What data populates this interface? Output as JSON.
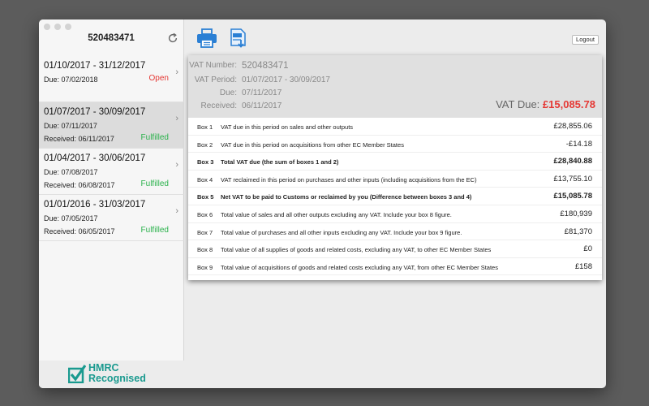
{
  "sidebar": {
    "title": "520483471",
    "periods": [
      {
        "range": "01/10/2017 - 31/12/2017",
        "line2": "Due: 07/02/2018",
        "line3": "",
        "status": "Open"
      },
      {
        "range": "01/07/2017 - 30/09/2017",
        "line2": "Due: 07/11/2017",
        "line3": "Received: 06/11/2017",
        "status": "Fulfilled"
      },
      {
        "range": "01/04/2017 - 30/06/2017",
        "line2": "Due: 07/08/2017",
        "line3": "Received: 06/08/2017",
        "status": "Fulfilled"
      },
      {
        "range": "01/01/2016 - 31/03/2017",
        "line2": "Due: 07/05/2017",
        "line3": "Received: 06/05/2017",
        "status": "Fulfilled"
      }
    ],
    "logo_text_1": "HMRC",
    "logo_text_2": "Recognised"
  },
  "toolbar": {
    "logout_label": "Logout"
  },
  "detail": {
    "vat_number_label": "VAT Number:",
    "vat_number": "520483471",
    "vat_period_label": "VAT Period:",
    "vat_period": "01/07/2017 - 30/09/2017",
    "due_label": "Due:",
    "due": "07/11/2017",
    "received_label": "Received:",
    "received": "06/11/2017",
    "vat_due_label": "VAT Due:",
    "vat_due": "£15,085.78",
    "boxes": [
      {
        "id": "Box 1",
        "desc": "VAT due in this period on sales and other outputs",
        "value": "£28,855.06"
      },
      {
        "id": "Box 2",
        "desc": "VAT due in this period on acquisitions from other EC Member States",
        "value": "-£14.18"
      },
      {
        "id": "Box 3",
        "desc": "Total VAT due (the sum of boxes 1 and 2)",
        "value": "£28,840.88"
      },
      {
        "id": "Box 4",
        "desc": "VAT reclaimed in this period on purchases and other inputs (including acquisitions from the EC)",
        "value": "£13,755.10"
      },
      {
        "id": "Box 5",
        "desc": "Net VAT to be paid to Customs or reclaimed by you (Difference between boxes 3 and 4)",
        "value": "£15,085.78"
      },
      {
        "id": "Box 6",
        "desc": "Total value of sales and all other outputs excluding any VAT. Include your box 8 figure.",
        "value": "£180,939"
      },
      {
        "id": "Box 7",
        "desc": "Total value of purchases and all other inputs excluding any VAT. Include your box 9 figure.",
        "value": "£81,370"
      },
      {
        "id": "Box 8",
        "desc": "Total value of all supplies of goods and related costs, excluding any VAT, to other EC Member States",
        "value": "£0"
      },
      {
        "id": "Box 9",
        "desc": "Total value of acquisitions of goods and related costs excluding any VAT, from other EC Member States",
        "value": "£158"
      }
    ]
  },
  "colors": {
    "open": "#e53935",
    "fulfilled": "#2bb24c",
    "accent_icon": "#2a7fd4",
    "hmrc": "#1a9a8f",
    "vat_due": "#e53935"
  },
  "icons": [
    "refresh-icon",
    "chevron-right-icon",
    "printer-icon",
    "export-document-icon",
    "checkbox-checked-icon"
  ]
}
